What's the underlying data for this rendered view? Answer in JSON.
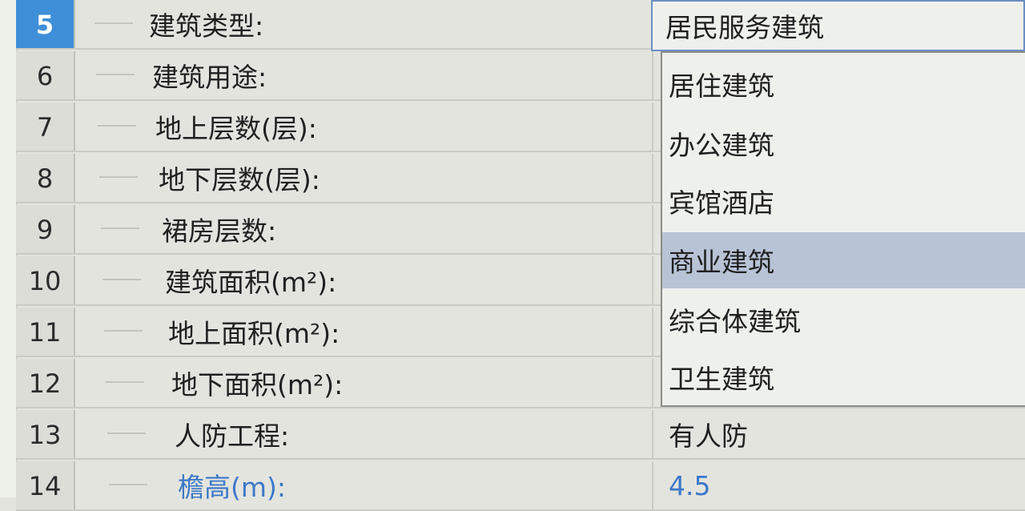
{
  "rows": [
    {
      "num": "5",
      "label": "建筑类型:"
    },
    {
      "num": "6",
      "label": "建筑用途:"
    },
    {
      "num": "7",
      "label": "地上层数(层):"
    },
    {
      "num": "8",
      "label": "地下层数(层):"
    },
    {
      "num": "9",
      "label": "裙房层数:"
    },
    {
      "num": "10",
      "label": "建筑面积(m²):"
    },
    {
      "num": "11",
      "label": "地上面积(m²):"
    },
    {
      "num": "12",
      "label": "地下面积(m²):"
    },
    {
      "num": "13",
      "label": "人防工程:",
      "value": "有人防"
    },
    {
      "num": "14",
      "label": "檐高(m):",
      "value": "4.5"
    }
  ],
  "dropdown": {
    "selected_value": "居民服务建筑",
    "options": [
      "居住建筑",
      "办公建筑",
      "宾馆酒店",
      "商业建筑",
      "综合体建筑",
      "卫生建筑"
    ],
    "highlighted": "商业建筑"
  },
  "colors": {
    "selected_row_header": "#3e8fd8",
    "highlight_option": "#b8c3d6",
    "blue_text": "#3c78c8"
  }
}
